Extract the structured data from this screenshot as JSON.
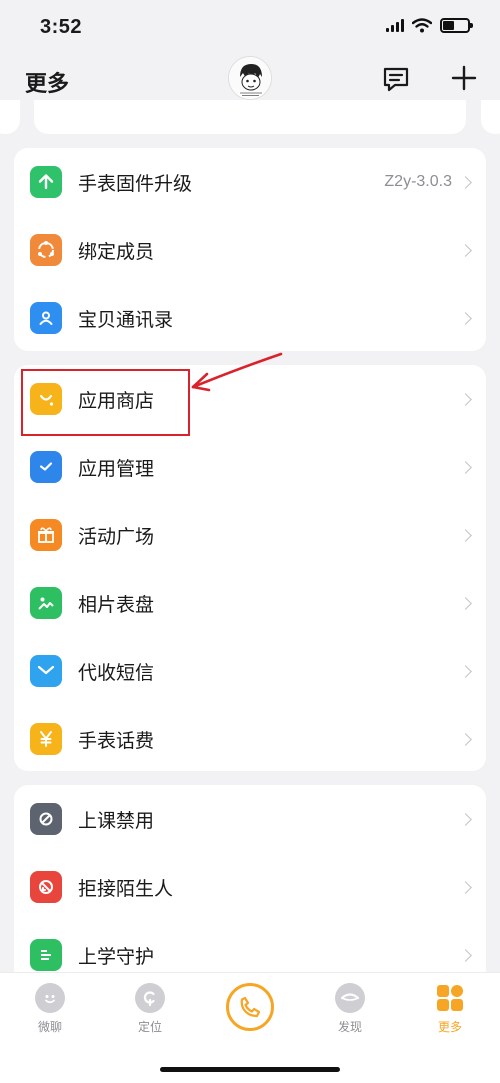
{
  "status_bar": {
    "time": "3:52"
  },
  "header": {
    "title": "更多"
  },
  "groups": [
    {
      "items": [
        {
          "label": "手表固件升级",
          "value": "Z2y-3.0.3",
          "icon": "upload-arrow-icon",
          "color": "#2fc26b"
        },
        {
          "label": "绑定成员",
          "icon": "members-ring-icon",
          "color": "#f08a3a"
        },
        {
          "label": "宝贝通讯录",
          "icon": "contacts-book-icon",
          "color": "#2f8ff0"
        }
      ]
    },
    {
      "items": [
        {
          "label": "应用商店",
          "icon": "shopping-bag-icon",
          "color": "#f7b31a"
        },
        {
          "label": "应用管理",
          "icon": "check-folder-icon",
          "color": "#2e86ea"
        },
        {
          "label": "活动广场",
          "icon": "gift-icon",
          "color": "#f58a24"
        },
        {
          "label": "相片表盘",
          "icon": "photo-icon",
          "color": "#2fbf63"
        },
        {
          "label": "代收短信",
          "icon": "envelope-icon",
          "color": "#2fa3ee"
        },
        {
          "label": "手表话费",
          "icon": "yuan-icon",
          "color": "#f7b31a"
        }
      ]
    },
    {
      "items": [
        {
          "label": "上课禁用",
          "icon": "no-watch-icon",
          "color": "#5d6470"
        },
        {
          "label": "拒接陌生人",
          "icon": "block-call-icon",
          "color": "#e8453c"
        },
        {
          "label": "上学守护",
          "icon": "school-guard-icon",
          "color": "#2fbf63"
        }
      ]
    }
  ],
  "tabbar": {
    "tabs": [
      {
        "label": "微聊",
        "icon": "chat-face-icon"
      },
      {
        "label": "定位",
        "icon": "location-icon"
      },
      {
        "label": "发现",
        "icon": "discover-eye-icon"
      },
      {
        "label": "更多",
        "icon": "grid-more-icon",
        "active": true
      }
    ],
    "call_icon": "phone-icon"
  },
  "colors": {
    "accent": "#f7a524",
    "highlight": "#d9222a",
    "background": "#f2f2f4"
  }
}
